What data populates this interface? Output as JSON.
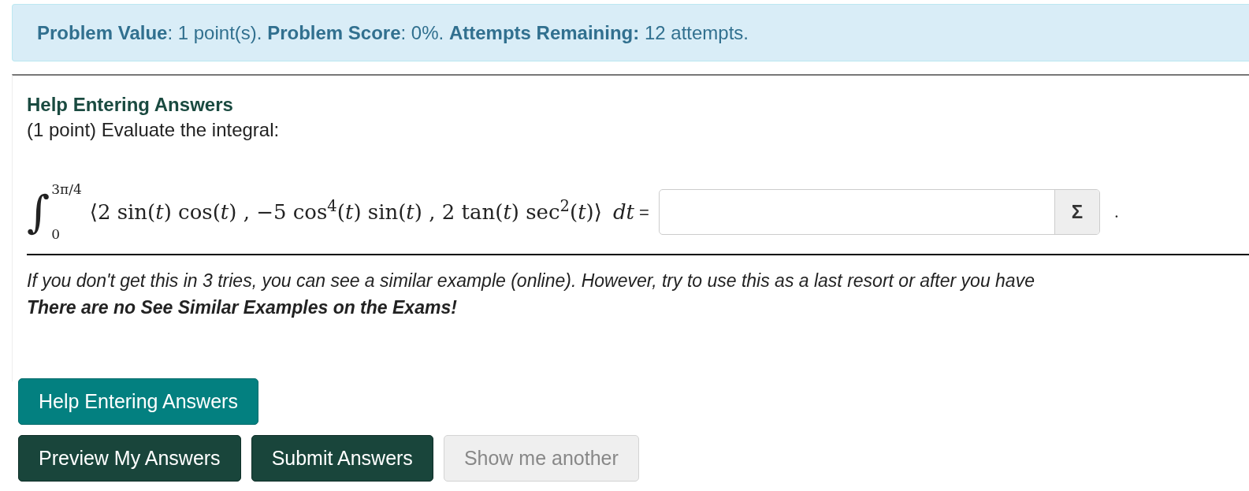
{
  "status": "**Problem Value**: 1 point(s). **Problem Score**: 0%. **Attempts Remaining:** 12 attempts.",
  "problem": {
    "title": "Help Entering Answers",
    "intro": "(1 point) Evaluate the integral:",
    "integral": {
      "sign": "∫",
      "upper": "3π/4",
      "lower": "0",
      "integrand": "⟨2 sin(*t*) cos(*t*) , −5 cos$^{4}$(*t*) sin(*t*) , 2 tan(*t*) sec$^{2}$(*t*)⟩",
      "differential": "dt",
      "equals": "=",
      "equation_button": "Σ",
      "end": "."
    },
    "hint": "If you don't get this in 3 tries, you can see a similar example (online). However, try to use this as a last resort or after you have",
    "warning": "There are no See Similar Examples on the Exams!"
  },
  "buttons": [
    {
      "label": "Help Entering Answers",
      "kind": "help",
      "disabled": false
    },
    {
      "label": "Preview My Answers",
      "kind": "primary",
      "disabled": false
    },
    {
      "label": "Submit Answers",
      "kind": "primary",
      "disabled": false
    },
    {
      "label": "Show me another",
      "kind": "secondary",
      "disabled": true
    }
  ]
}
